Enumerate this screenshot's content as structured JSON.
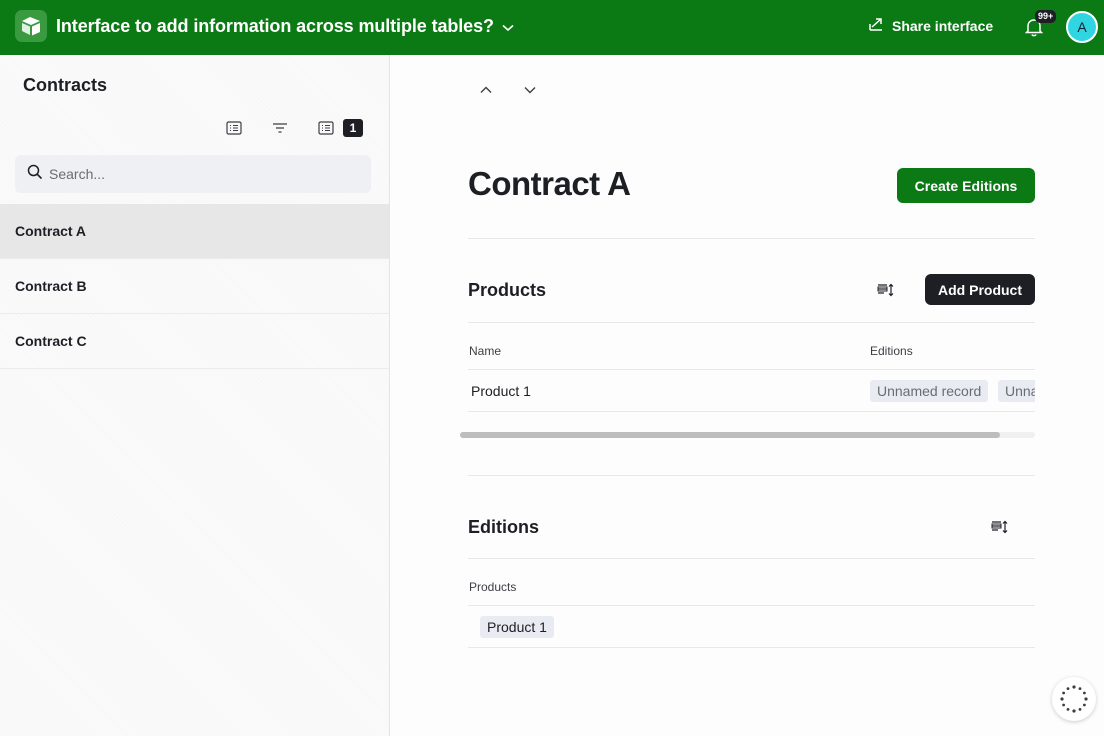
{
  "header": {
    "title": "Interface to add information across multiple tables?",
    "share_label": "Share interface",
    "notifications_count": "99+",
    "avatar_initial": "A",
    "brand_color": "#0b7a15"
  },
  "sidebar": {
    "title": "Contracts",
    "sort_count": "1",
    "search_placeholder": "Search...",
    "records": [
      {
        "label": "Contract A",
        "selected": true
      },
      {
        "label": "Contract B",
        "selected": false
      },
      {
        "label": "Contract C",
        "selected": false
      }
    ]
  },
  "main": {
    "record_title": "Contract A",
    "create_editions_label": "Create Editions",
    "products": {
      "title": "Products",
      "add_label": "Add Product",
      "columns": [
        "Name",
        "Editions"
      ],
      "rows": [
        {
          "name": "Product 1",
          "editions": [
            "Unnamed record",
            "Unna"
          ]
        }
      ]
    },
    "editions": {
      "title": "Editions",
      "columns": [
        "Products"
      ],
      "rows": [
        {
          "products": [
            "Product 1"
          ]
        }
      ]
    }
  },
  "icons": {
    "logo": "airtable-logo-icon",
    "share": "share-icon",
    "bell": "bell-icon",
    "search": "search-icon",
    "filter": "filter-icon",
    "sort": "sort-icon",
    "prev": "chevron-up-icon",
    "next": "chevron-down-icon",
    "loader": "loading-spinner-icon"
  }
}
